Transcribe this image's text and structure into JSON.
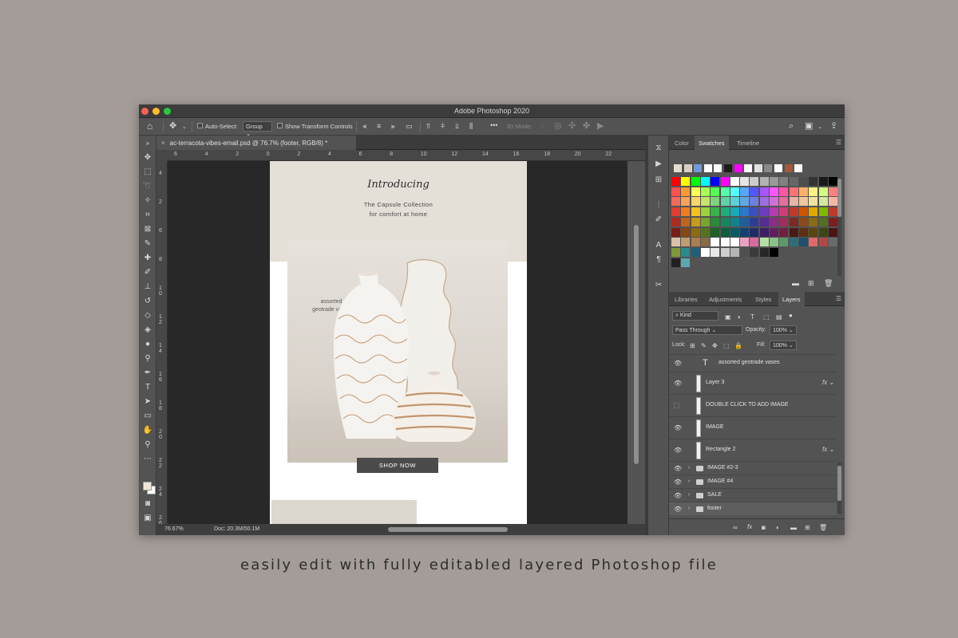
{
  "app": {
    "title": "Adobe Photoshop 2020"
  },
  "options": {
    "auto_select_label": "Auto-Select:",
    "group_value": "Group",
    "show_transform_label": "Show Transform Controls",
    "more_label": "•••",
    "mode_3d_label": "3D Mode:"
  },
  "document": {
    "tab_close": "×",
    "tab_title": "ac-terracota-vibes-email.psd @ 76.7% (footer, RGB/8) *",
    "ruler_h": [
      "6",
      "4",
      "2",
      "0",
      "2",
      "4",
      "6",
      "8",
      "10",
      "12",
      "14",
      "16",
      "18",
      "20",
      "22"
    ],
    "ruler_v": [
      "4",
      "2",
      "6",
      "8",
      "1 0",
      "1 2",
      "1 4",
      "1 6",
      "1 8",
      "2 0",
      "2 2",
      "2 4",
      "2 6"
    ],
    "zoom": "76.67%",
    "doc_size": "Doc: 20.3M/50.1M"
  },
  "email": {
    "heading": "Introducing",
    "subtitle_line1": "The Capsule Collection",
    "subtitle_line2": "for comfort at home",
    "photo_caption_line1": "assorted",
    "photo_caption_line2": "geotrade vases",
    "button_label": "SHOP NOW"
  },
  "color_panel": {
    "tabs": [
      "Color",
      "Swatches",
      "Timeline"
    ],
    "active_tab": "Swatches",
    "recent_colors": [
      "#e4ded0",
      "#d8cfbd",
      "#6f9ad6",
      "#ffffff",
      "#ffffff",
      "#1c1c1c",
      "#ff00ff",
      "#ffffff",
      "#e1e1e1",
      "#8a8a8a",
      "#ffffff",
      "#9e5a3a",
      "#ffffff"
    ],
    "swatch_rows": [
      [
        "#ff0000",
        "#ffff00",
        "#00ff00",
        "#00ffff",
        "#0000ff",
        "#ff00ff",
        "#ffffff",
        "#e6e6e6",
        "#cccccc",
        "#b3b3b3",
        "#999999",
        "#808080",
        "#666666",
        "#4d4d4d",
        "#333333",
        "#1a1a1a",
        "#000000"
      ],
      [
        "#ff5050",
        "#ff9933",
        "#ffff55",
        "#a6ff55",
        "#55ff55",
        "#55ffa6",
        "#55ffff",
        "#55a6ff",
        "#5555ff",
        "#a655ff",
        "#ff55ff",
        "#ff55a6",
        "#ff7373",
        "#ffb066",
        "#fff080",
        "#d0ff80",
        "#ff8080"
      ],
      [
        "#f26a5c",
        "#f7a35c",
        "#fad56b",
        "#c6e36a",
        "#7fd27f",
        "#5fd1a6",
        "#5fcfd6",
        "#5fa8e6",
        "#6e7fe0",
        "#9b6fe0",
        "#d46fd6",
        "#e36f9f",
        "#e8b3a5",
        "#efc79c",
        "#f2e2a0",
        "#d5e8a0",
        "#f5b8a8"
      ],
      [
        "#e03c31",
        "#ef7d22",
        "#f4c220",
        "#9ed13b",
        "#37b34a",
        "#1fad7a",
        "#19a9b6",
        "#2a78c9",
        "#3b4fbf",
        "#6e3bbf",
        "#b53bb0",
        "#d13b78",
        "#c0392b",
        "#d35400",
        "#e0a800",
        "#7fb800",
        "#c0392b"
      ],
      [
        "#b02a22",
        "#c0651a",
        "#c79b17",
        "#7aa52c",
        "#2a8a39",
        "#17855d",
        "#13818c",
        "#205d9c",
        "#2d3d92",
        "#542d92",
        "#8b2d87",
        "#a12d5c",
        "#7a2a22",
        "#8a4a1a",
        "#8a6b14",
        "#556e1f",
        "#7a1f1f"
      ],
      [
        "#7a1d17",
        "#874612",
        "#8c6c10",
        "#55741f",
        "#1d6128",
        "#105d41",
        "#0d5a62",
        "#16416e",
        "#1f2b66",
        "#3b1f66",
        "#611f5f",
        "#711f41",
        "#4a1a15",
        "#5a3010",
        "#5a460d",
        "#384714",
        "#4a1515"
      ],
      [
        "#d9c2a7",
        "#c09c73",
        "#a97f4e",
        "#8b6a45",
        "#ffffff",
        "#ffffff",
        "#ffffff",
        "#e8a3c2",
        "#d86aa2",
        "#b6e0a8",
        "#8cc28a",
        "#5d9a6b",
        "#2d6e7a",
        "#1f4f6e",
        "#e06a6a",
        "#b34747",
        "#6b6b6b"
      ],
      [
        "#7f9a3a",
        "#2b8a8a",
        "#1f5f7a",
        "#ffffff",
        "#e8e8e8",
        "#cfcfcf",
        "#b5b5b5",
        "#4f4f4f",
        "#3a3a3a",
        "#262626",
        "#000000"
      ],
      [
        "#202020",
        "#5aa9b0"
      ]
    ]
  },
  "layers_panel": {
    "tabs": [
      "Libraries",
      "Adjustments",
      "Styles",
      "Layers"
    ],
    "active_tab": "Layers",
    "kind_label": "Kind",
    "blend_mode": "Pass Through",
    "opacity_label": "Opacity:",
    "opacity_value": "100%",
    "lock_label": "Lock:",
    "fill_label": "Fill:",
    "fill_value": "100%",
    "items": [
      {
        "name": "assorted geotrade vases",
        "kind": "text",
        "visible": true,
        "fx": false,
        "label": "T"
      },
      {
        "name": "Layer 3",
        "kind": "image",
        "visible": true,
        "fx": true,
        "label": ""
      },
      {
        "name": "DOUBLE CLICK TO ADD IMAGE",
        "kind": "image",
        "visible": false,
        "fx": false,
        "label": ""
      },
      {
        "name": "IMAGE",
        "kind": "image",
        "visible": true,
        "fx": false,
        "label": ""
      },
      {
        "name": "Rectangle 2",
        "kind": "image",
        "visible": true,
        "fx": true,
        "label": ""
      },
      {
        "name": "IMAGE #2-3",
        "kind": "group",
        "visible": true,
        "fx": false,
        "label": ""
      },
      {
        "name": "IMAGE #4",
        "kind": "group",
        "visible": true,
        "fx": false,
        "label": ""
      },
      {
        "name": "SALE",
        "kind": "group",
        "visible": true,
        "fx": false,
        "label": ""
      },
      {
        "name": "footer",
        "kind": "group",
        "visible": true,
        "fx": false,
        "label": "",
        "selected": true
      }
    ],
    "fx_label": "fx",
    "eye_symbol": "👁",
    "folder_arrow": "›"
  },
  "caption": "easily edit with fully editabled layered Photoshop file"
}
